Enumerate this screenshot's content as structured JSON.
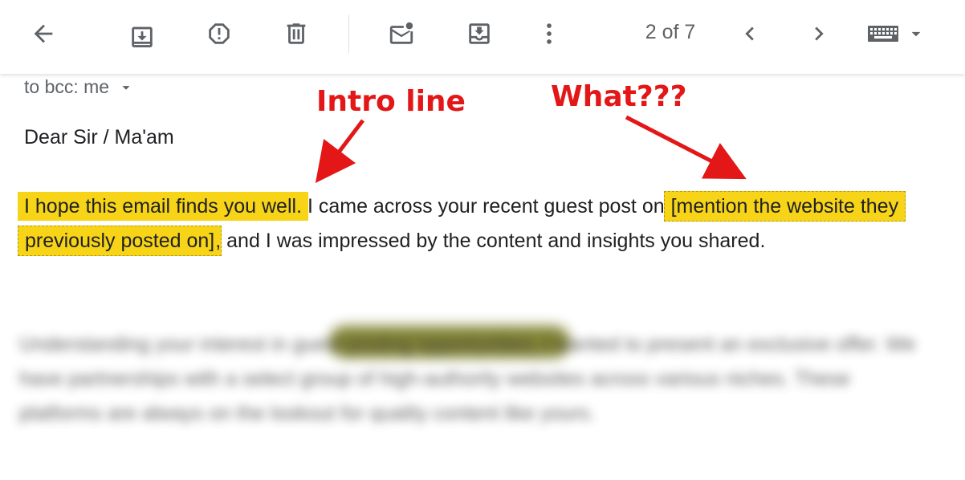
{
  "toolbar": {
    "page_counter": "2 of 7",
    "icons": [
      "back-arrow-icon",
      "archive-icon",
      "report-spam-icon",
      "delete-icon",
      "mark-unread-icon",
      "move-to-icon",
      "more-options-icon",
      "prev-icon",
      "next-icon",
      "keyboard-icon",
      "dropdown-icon"
    ]
  },
  "email": {
    "recipient": "to bcc: me",
    "greeting": "Dear Sir / Ma'am",
    "body": {
      "intro": "I hope this email finds you well.",
      "mid1": " I came across your recent guest post on ",
      "placeholder": "[mention the website they previously posted on]",
      "mid2": ", and I was impressed by the content and insights you shared."
    },
    "blurred_text": "Understanding your interest in guest posting opportunities, I wanted to present an exclusive offer. We have partnerships with a select group of high-authority websites across various niches. These platforms are always on the lookout for quality content like yours."
  },
  "annotations": {
    "intro_label": "Intro line",
    "what_label": "What???",
    "color": "#e31717"
  },
  "colors": {
    "highlight": "#f7d417"
  }
}
